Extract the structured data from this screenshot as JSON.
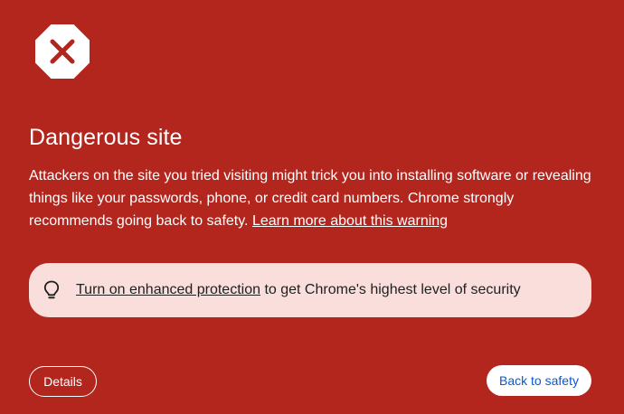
{
  "header": {
    "icon": "danger-octagon-icon",
    "title": "Dangerous site"
  },
  "warning": {
    "description": "Attackers on the site you tried visiting might trick you into installing software or revealing things like your passwords, phone, or credit card numbers. Chrome strongly recommends going back to safety.",
    "learn_more_link": "Learn more about this warning"
  },
  "promo": {
    "icon": "lightbulb-icon",
    "link_text": "Turn on enhanced protection",
    "text": "to get Chrome's highest level of security"
  },
  "actions": {
    "details_label": "Details",
    "back_label": "Back to safety"
  },
  "colors": {
    "background": "#b3261e",
    "promo_background": "#f9dedc",
    "primary_button_text": "#0b57d0"
  }
}
